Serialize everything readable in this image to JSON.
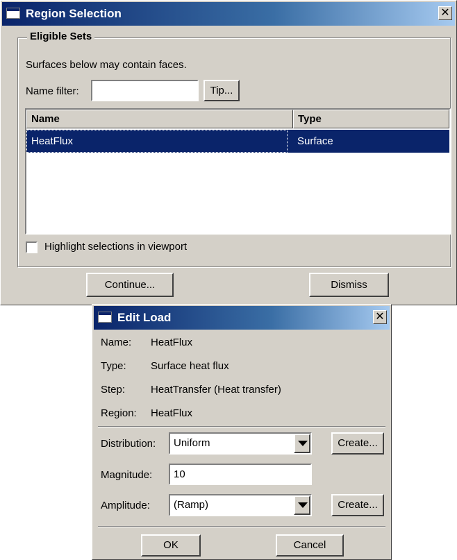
{
  "region_selection": {
    "title": "Region Selection",
    "close_glyph": "✕",
    "group_title": "Eligible Sets",
    "info_text": "Surfaces below may contain faces.",
    "name_filter_label": "Name filter:",
    "name_filter_value": "",
    "tip_button": "Tip...",
    "table": {
      "columns": [
        "Name",
        "Type"
      ],
      "rows": [
        {
          "name": "HeatFlux",
          "type": "Surface",
          "selected": true
        }
      ]
    },
    "highlight_checkbox_label": "Highlight selections in viewport",
    "highlight_checked": false,
    "continue_button": "Continue...",
    "dismiss_button": "Dismiss"
  },
  "edit_load": {
    "title": "Edit Load",
    "close_glyph": "✕",
    "info": {
      "name_label": "Name:",
      "name_value": "HeatFlux",
      "type_label": "Type:",
      "type_value": "Surface heat flux",
      "step_label": "Step:",
      "step_value": "HeatTransfer (Heat transfer)",
      "region_label": "Region:",
      "region_value": "HeatFlux"
    },
    "distribution_label": "Distribution:",
    "distribution_value": "Uniform",
    "distribution_create_button": "Create...",
    "magnitude_label": "Magnitude:",
    "magnitude_value": "10",
    "amplitude_label": "Amplitude:",
    "amplitude_value": "(Ramp)",
    "amplitude_create_button": "Create...",
    "ok_button": "OK",
    "cancel_button": "Cancel"
  },
  "colors": {
    "dialog_face": "#d4d0c8",
    "title_active": "#0a246a",
    "selection": "#0a246a"
  }
}
